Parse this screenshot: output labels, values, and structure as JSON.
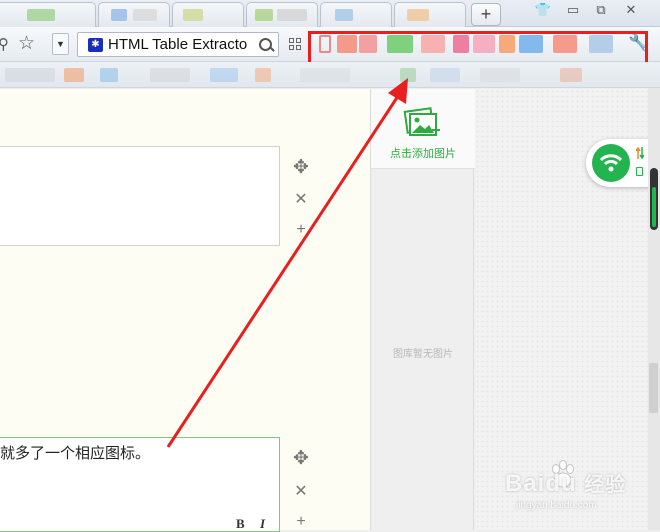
{
  "browser": {
    "new_tab_label": "+",
    "search_text": "HTML Table Extracto",
    "engine_icon": "paw-icon",
    "window_buttons": [
      "shirt-icon",
      "minimize-icon",
      "restore-icon",
      "close-icon"
    ]
  },
  "editor": {
    "block2_text": "就多了一个相应图标。",
    "bold_label": "B",
    "italic_label": "I"
  },
  "image_panel": {
    "add_image_label": "点击添加图片",
    "empty_label": "图库暂无图片"
  },
  "network_widget": {
    "speed_text": "0."
  },
  "watermark": {
    "brand": "Baidu",
    "cn_brand": "经验",
    "url": "jingyan.baidu.com"
  },
  "colors": {
    "annotation_red": "#e81f1f",
    "accent_green": "#2eaa3f",
    "wifi_green": "#23b34f"
  }
}
